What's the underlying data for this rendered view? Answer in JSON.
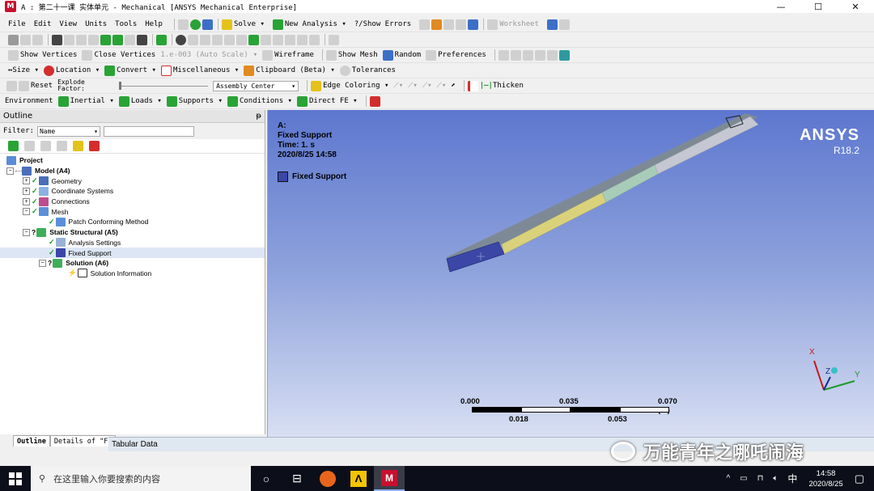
{
  "window": {
    "title": "A : 第二十一课 实体单元 - Mechanical [ANSYS Mechanical Enterprise]",
    "app_icon": "M"
  },
  "menu": [
    "File",
    "Edit",
    "View",
    "Units",
    "Tools",
    "Help"
  ],
  "toolbar1": {
    "solve": "Solve",
    "new_analysis": "New Analysis",
    "show_errors": "?/Show Errors",
    "worksheet": "Worksheet"
  },
  "toolbar3": {
    "show_vertices": "Show Vertices",
    "close_vertices": "Close Vertices",
    "auto_scale_value": "1.e-003 (Auto Scale)",
    "wireframe": "Wireframe",
    "show_mesh": "Show Mesh",
    "random": "Random",
    "preferences": "Preferences"
  },
  "toolbar4": {
    "size": "Size",
    "location": "Location",
    "convert": "Convert",
    "miscellaneous": "Miscellaneous",
    "clipboard": "Clipboard (Beta)",
    "tolerances": "Tolerances"
  },
  "toolbar5": {
    "reset": "Reset",
    "explode_factor": "Explode Factor:",
    "assembly_center": "Assembly Center",
    "edge_coloring": "Edge Coloring",
    "thicken": "Thicken"
  },
  "toolbar6": {
    "environment": "Environment",
    "inertial": "Inertial",
    "loads": "Loads",
    "supports": "Supports",
    "conditions": "Conditions",
    "direct_fe": "Direct FE"
  },
  "outline": {
    "title": "Outline",
    "pin": "ᵽ",
    "filter_label": "Filter:",
    "filter_value": "Name",
    "tree": [
      {
        "label": "Project",
        "bold": true
      },
      {
        "label": "Model (A4)",
        "bold": true
      },
      {
        "label": "Geometry",
        "bold": false
      },
      {
        "label": "Coordinate Systems",
        "bold": false
      },
      {
        "label": "Connections",
        "bold": false
      },
      {
        "label": "Mesh",
        "bold": false
      },
      {
        "label": "Patch Conforming Method",
        "bold": false
      },
      {
        "label": "Static Structural (A5)",
        "bold": true
      },
      {
        "label": "Analysis Settings",
        "bold": false
      },
      {
        "label": "Fixed Support",
        "bold": false
      },
      {
        "label": "Solution (A6)",
        "bold": true
      },
      {
        "label": "Solution Information",
        "bold": false
      }
    ]
  },
  "bottom_tabs": {
    "outline": "Outline",
    "details": "Details of \"Fi"
  },
  "tabular": "Tabular Data",
  "viewport": {
    "info_lines": [
      "A:",
      "Fixed Support",
      "Time: 1. s",
      "2020/8/25 14:58"
    ],
    "legend": "Fixed Support",
    "legend_color": "#3b46a6",
    "brand": "ANSYS",
    "version": "R18.2",
    "scale_top": [
      "0.000",
      "0.035",
      "0.070 (m)"
    ],
    "scale_bottom": [
      "0.018",
      "0.053"
    ]
  },
  "taskbar": {
    "search_placeholder": "在这里输入你要搜索的内容",
    "time": "14:58",
    "date": "2020/8/25",
    "ime": "中"
  },
  "watermark": "万能青年之哪吒闹海"
}
